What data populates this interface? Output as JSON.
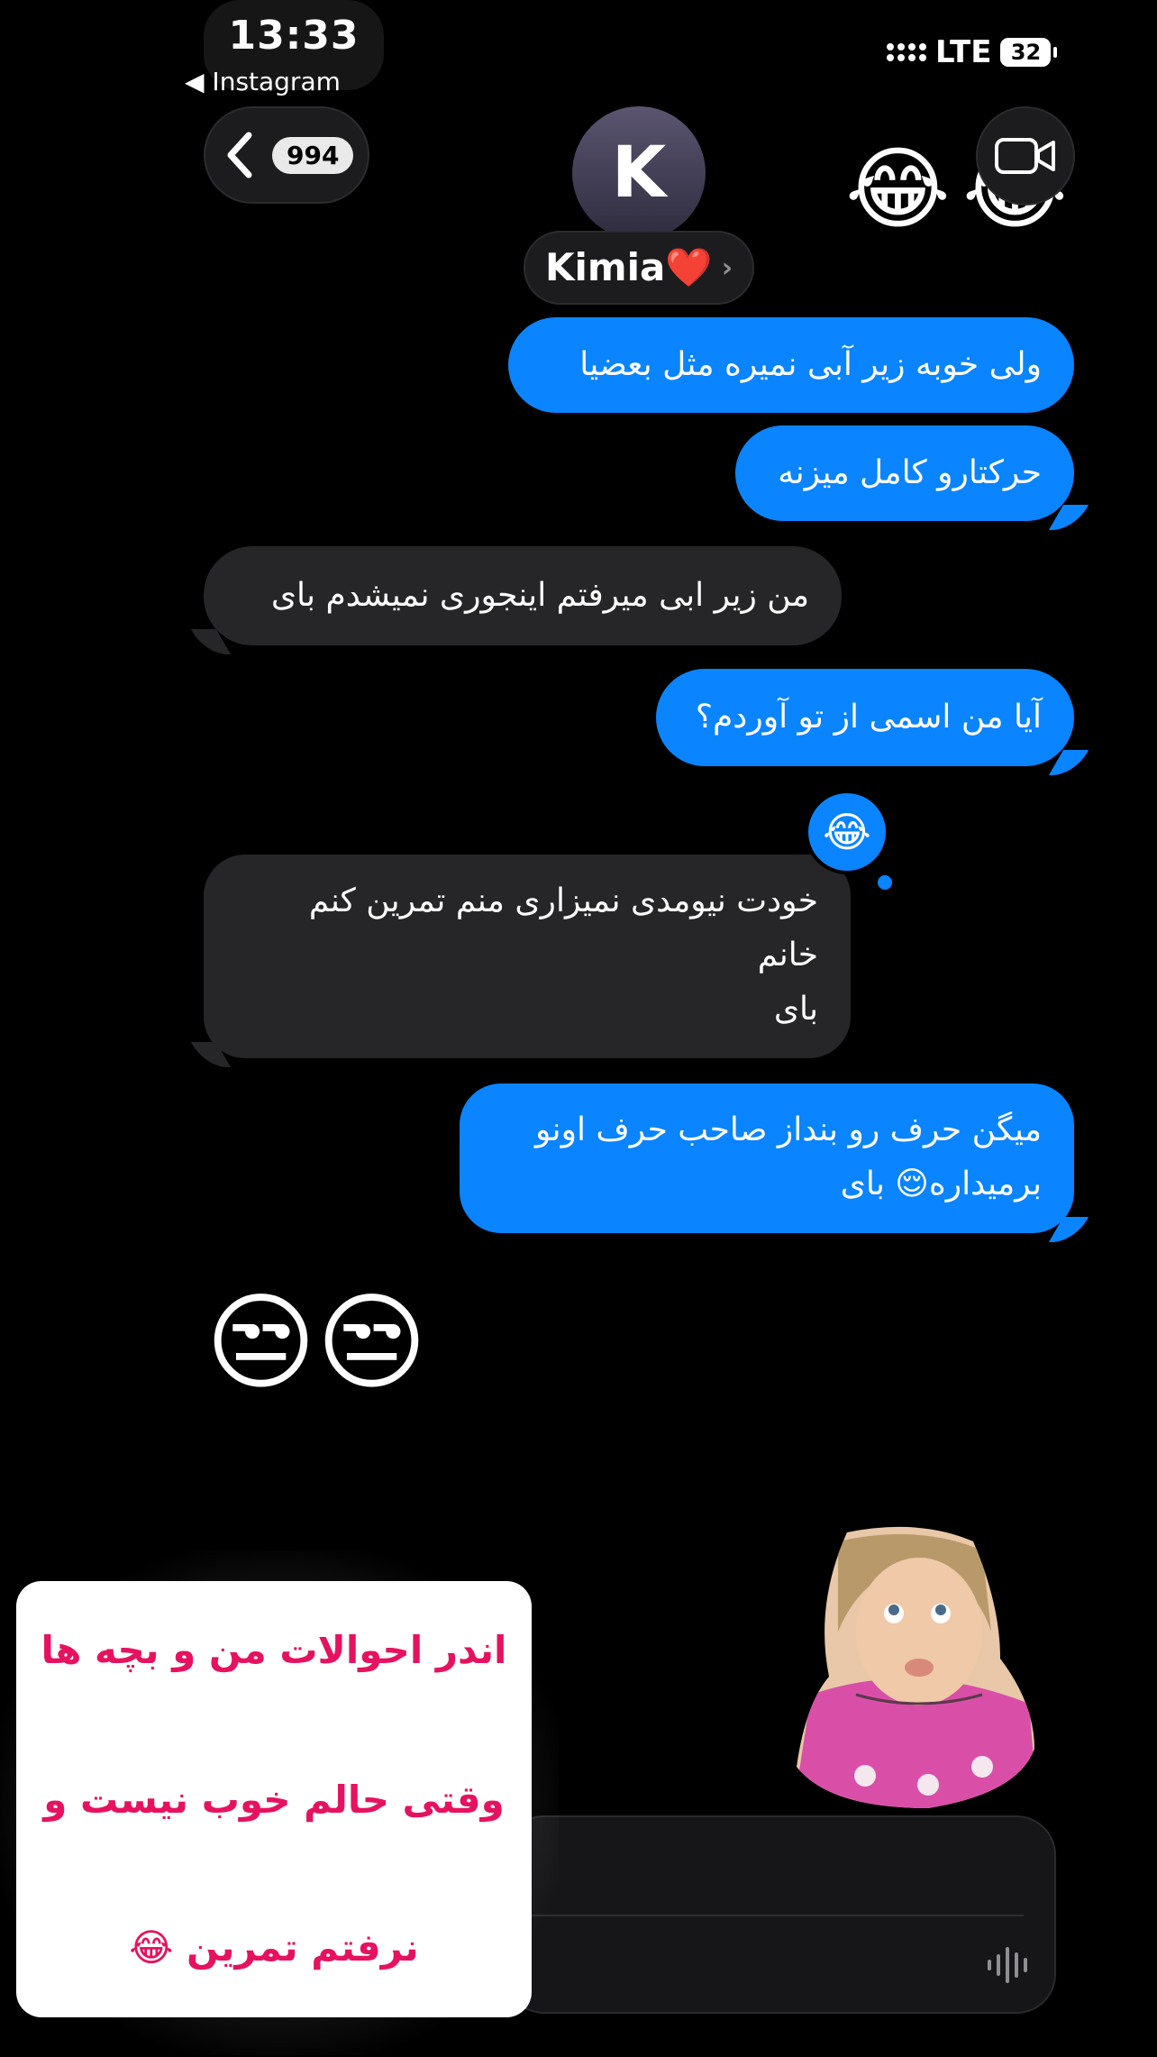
{
  "status_bar": {
    "time": "13:33",
    "back_app": "◀ Instagram",
    "network": "LTE",
    "battery": "32"
  },
  "header": {
    "back_count": "994",
    "avatar_letter": "K",
    "contact_name": "Kimia❤️",
    "name_chevron": "›",
    "top_reaction_emoji": "😂"
  },
  "messages": [
    {
      "dir": "out",
      "text": "ولی خوبه زیر آبی نمیره مثل بعضیا"
    },
    {
      "dir": "out",
      "text": "حرکتارو کامل میزنه"
    },
    {
      "dir": "in",
      "text": "من زیر ابی میرفتم اینجوری نمیشدم بای"
    },
    {
      "dir": "out",
      "text": "آیا من اسمی از تو آوردم؟"
    },
    {
      "dir": "in",
      "lines": [
        "خودت نیومدی نمیزاری منم تمرین کنم",
        "خانم",
        "بای"
      ],
      "reaction": "😂"
    },
    {
      "dir": "out",
      "lines": [
        "میگن حرف رو بنداز صاحب حرف اونو",
        "برمیداره😌 بای"
      ]
    },
    {
      "dir": "in",
      "emoji": "😒😒"
    }
  ],
  "story_card": {
    "line1": "اندر احوالات من و بچه ها",
    "line2": "وقتی حالم خوب نیست و",
    "line3": "نرفتم تمرین 😂"
  },
  "colors": {
    "outgoing_bubble": "#0a84ff",
    "incoming_bubble": "#262628",
    "story_text": "#e6125f"
  },
  "icons": [
    "chevron-left-icon",
    "video-camera-icon",
    "microphone-waveform-icon",
    "cellular-signal-icon",
    "battery-icon"
  ]
}
